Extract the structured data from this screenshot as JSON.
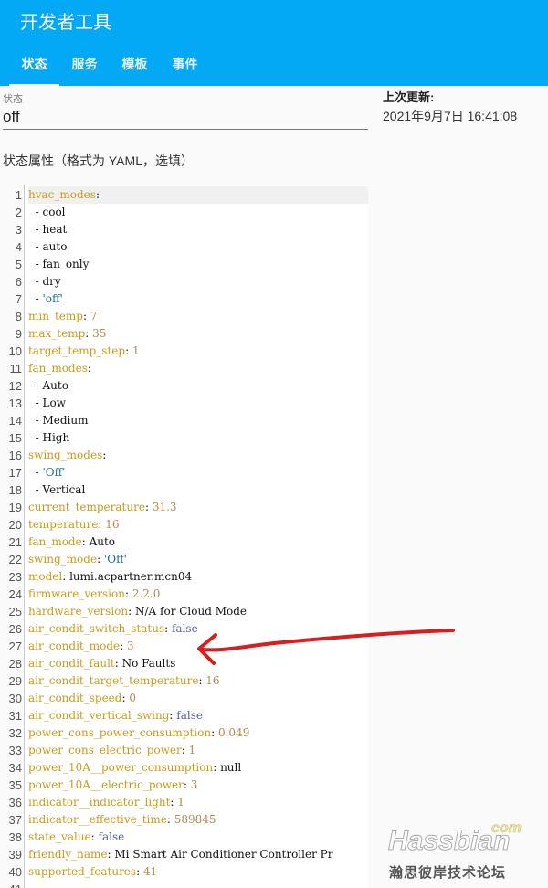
{
  "header": {
    "title": "开发者工具",
    "tabs": [
      {
        "label": "状态",
        "active": true
      },
      {
        "label": "服务"
      },
      {
        "label": "模板"
      },
      {
        "label": "事件"
      }
    ]
  },
  "state": {
    "label": "状态",
    "value": "off"
  },
  "last_updated": {
    "label": "上次更新:",
    "value": "2021年9月7日 16:41:08"
  },
  "attributes_label": "状态属性（格式为 YAML，选填）",
  "editor": {
    "lines": [
      {
        "k": "hvac_modes",
        "v": "",
        "t": "p"
      },
      {
        "item": true,
        "v": "cool",
        "t": "p"
      },
      {
        "item": true,
        "v": "heat",
        "t": "p"
      },
      {
        "item": true,
        "v": "auto",
        "t": "p"
      },
      {
        "item": true,
        "v": "fan_only",
        "t": "p"
      },
      {
        "item": true,
        "v": "dry",
        "t": "p"
      },
      {
        "item": true,
        "v": "'off'",
        "t": "s"
      },
      {
        "k": "min_temp",
        "v": "7",
        "t": "n"
      },
      {
        "k": "max_temp",
        "v": "35",
        "t": "n"
      },
      {
        "k": "target_temp_step",
        "v": "1",
        "t": "n"
      },
      {
        "k": "fan_modes",
        "v": "",
        "t": "p"
      },
      {
        "item": true,
        "v": "Auto",
        "t": "p"
      },
      {
        "item": true,
        "v": "Low",
        "t": "p"
      },
      {
        "item": true,
        "v": "Medium",
        "t": "p"
      },
      {
        "item": true,
        "v": "High",
        "t": "p"
      },
      {
        "k": "swing_modes",
        "v": "",
        "t": "p"
      },
      {
        "item": true,
        "v": "'Off'",
        "t": "s"
      },
      {
        "item": true,
        "v": "Vertical",
        "t": "p"
      },
      {
        "k": "current_temperature",
        "v": "31.3",
        "t": "n"
      },
      {
        "k": "temperature",
        "v": "16",
        "t": "n"
      },
      {
        "k": "fan_mode",
        "v": "Auto",
        "t": "p"
      },
      {
        "k": "swing_mode",
        "v": "'Off'",
        "t": "s"
      },
      {
        "k": "model",
        "v": "lumi.acpartner.mcn04",
        "t": "p"
      },
      {
        "k": "firmware_version",
        "v": "2.2.0",
        "t": "n"
      },
      {
        "k": "hardware_version",
        "v": "N/A for Cloud Mode",
        "t": "p"
      },
      {
        "k": "air_condit_switch_status",
        "v": "false",
        "t": "b"
      },
      {
        "k": "air_condit_mode",
        "v": "3",
        "t": "n"
      },
      {
        "k": "air_condit_fault",
        "v": "No Faults",
        "t": "p"
      },
      {
        "k": "air_condit_target_temperature",
        "v": "16",
        "t": "n"
      },
      {
        "k": "air_condit_speed",
        "v": "0",
        "t": "n"
      },
      {
        "k": "air_condit_vertical_swing",
        "v": "false",
        "t": "b"
      },
      {
        "k": "power_cons_power_consumption",
        "v": "0.049",
        "t": "n"
      },
      {
        "k": "power_cons_electric_power",
        "v": "1",
        "t": "n"
      },
      {
        "k": "power_10A__power_consumption",
        "v": "null",
        "t": "p"
      },
      {
        "k": "power_10A__electric_power",
        "v": "3",
        "t": "n"
      },
      {
        "k": "indicator__indicator_light",
        "v": "1",
        "t": "n"
      },
      {
        "k": "indicator__effective_time",
        "v": "589845",
        "t": "n"
      },
      {
        "k": "state_value",
        "v": "false",
        "t": "b"
      },
      {
        "k": "friendly_name",
        "v": "Mi Smart Air Conditioner Controller Pr",
        "t": "p"
      },
      {
        "k": "supported_features",
        "v": "41",
        "t": "n"
      },
      {
        "v": "",
        "t": "p"
      }
    ]
  },
  "watermark": {
    "brand": "Hassbian",
    "tld": "com",
    "subtitle": "瀚思彼岸技术论坛"
  },
  "colors": {
    "header": "#03a9f4",
    "annotation_arrow": "#d81e1e"
  }
}
